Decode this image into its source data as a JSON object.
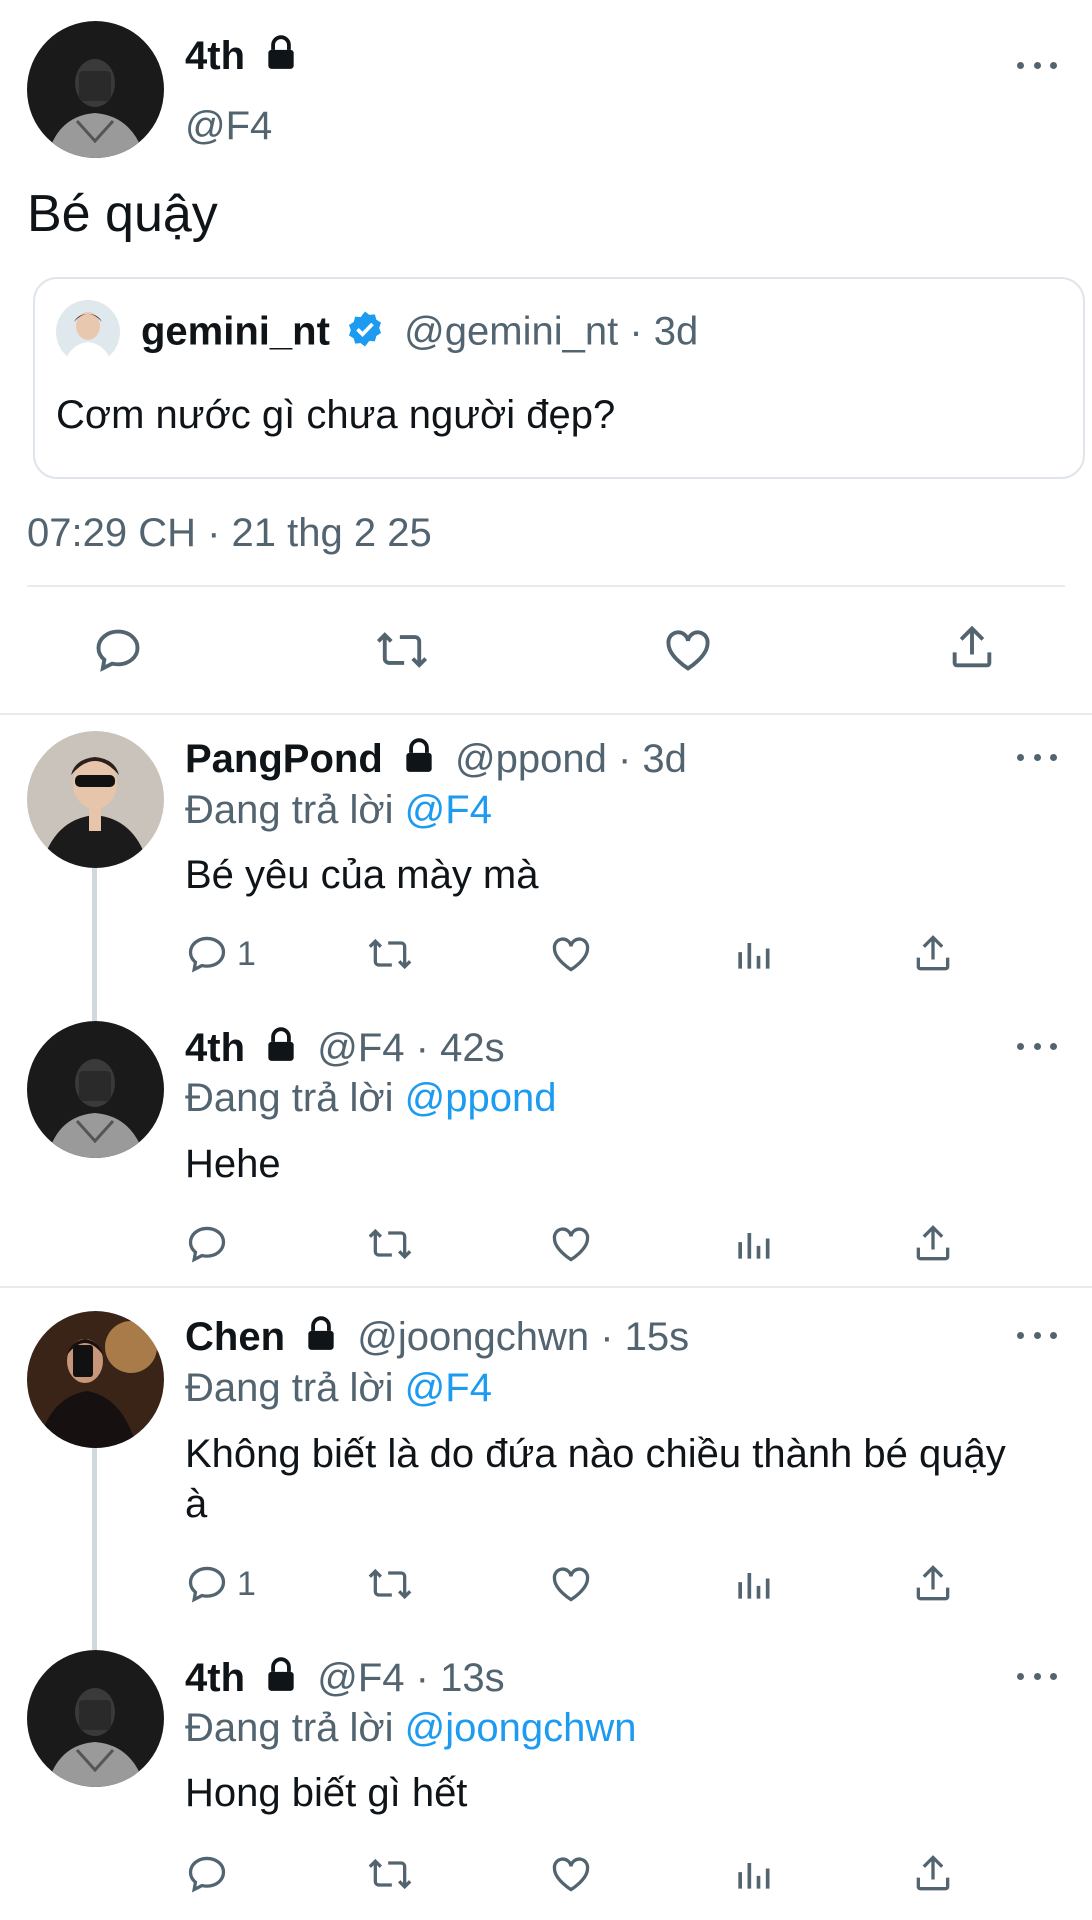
{
  "main_tweet": {
    "name": "4th",
    "handle": "@F4",
    "text": "Bé quậy",
    "timestamp": "07:29 CH · 21 thg 2 25",
    "avatar_icon": "avatar-dark-photo",
    "lock_icon": "lock-icon",
    "quote": {
      "name": "gemini_nt",
      "handle_time": "@gemini_nt · 3d",
      "verified_icon": "verified-badge-icon",
      "text": "Cơm nước gì chưa người đẹp?"
    }
  },
  "replies": [
    {
      "name": "PangPond",
      "meta": "@ppond · 3d",
      "reply_prefix": "Đang trả lời ",
      "reply_to": "@F4",
      "text": "Bé yêu của mày mà",
      "reply_count": "1"
    },
    {
      "name": "4th",
      "meta": "@F4 · 42s",
      "reply_prefix": "Đang trả lời ",
      "reply_to": "@ppond",
      "text": "Hehe",
      "reply_count": ""
    },
    {
      "name": "Chen",
      "meta": "@joongchwn · 15s",
      "reply_prefix": "Đang trả lời ",
      "reply_to": "@F4",
      "text": "Không biết là do đứa nào chiều thành bé quậy à",
      "reply_count": "1"
    },
    {
      "name": "4th",
      "meta": "@F4 · 13s",
      "reply_prefix": "Đang trả lời ",
      "reply_to": "@joongchwn",
      "text": "Hong biết gì hết",
      "reply_count": ""
    }
  ],
  "colors": {
    "link": "#1d9bf0",
    "muted": "#536471",
    "text": "#0f1419",
    "divider": "#e6ecf0"
  }
}
